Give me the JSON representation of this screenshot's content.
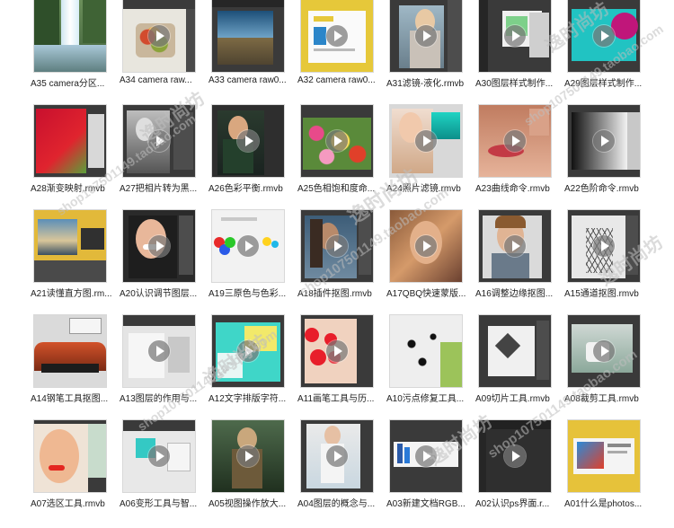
{
  "tiles": [
    {
      "caption": "A35 camera分区..."
    },
    {
      "caption": "A34 camera raw..."
    },
    {
      "caption": "A33 camera raw0..."
    },
    {
      "caption": "A32 camera raw0..."
    },
    {
      "caption": "A31滤镜-液化.rmvb"
    },
    {
      "caption": "A30图层样式制作..."
    },
    {
      "caption": "A29图层样式制作..."
    },
    {
      "caption": "A28渐变映射.rmvb"
    },
    {
      "caption": "A27把相片转为黑..."
    },
    {
      "caption": "A26色彩平衡.rmvb"
    },
    {
      "caption": "A25色相饱和度命..."
    },
    {
      "caption": "A24照片滤镜.rmvb"
    },
    {
      "caption": "A23曲线命令.rmvb"
    },
    {
      "caption": "A22色阶命令.rmvb"
    },
    {
      "caption": "A21读懂直方图.rm..."
    },
    {
      "caption": "A20认识调节图层..."
    },
    {
      "caption": "A19三原色与色彩..."
    },
    {
      "caption": "A18插件抠图.rmvb"
    },
    {
      "caption": "A17QBQ快速蒙版..."
    },
    {
      "caption": "A16调整边缘抠图..."
    },
    {
      "caption": "A15通道抠图.rmvb"
    },
    {
      "caption": "A14钢笔工具抠图..."
    },
    {
      "caption": "A13图层的作用与..."
    },
    {
      "caption": "A12文字排版字符..."
    },
    {
      "caption": "A11画笔工具与历..."
    },
    {
      "caption": "A10污点修复工具..."
    },
    {
      "caption": "A09切片工具.rmvb"
    },
    {
      "caption": "A08裁剪工具.rmvb"
    },
    {
      "caption": "A07选区工具.rmvb"
    },
    {
      "caption": "A06变形工具与智..."
    },
    {
      "caption": "A05视图操作放大..."
    },
    {
      "caption": "A04图层的概念与..."
    },
    {
      "caption": "A03新建文档RGB..."
    },
    {
      "caption": "A02认识ps界面.r..."
    },
    {
      "caption": "A01什么是photos..."
    }
  ],
  "watermarks": {
    "shop_url": "shop107501149.taobao.com",
    "shop_name": "逸时尚坊"
  }
}
